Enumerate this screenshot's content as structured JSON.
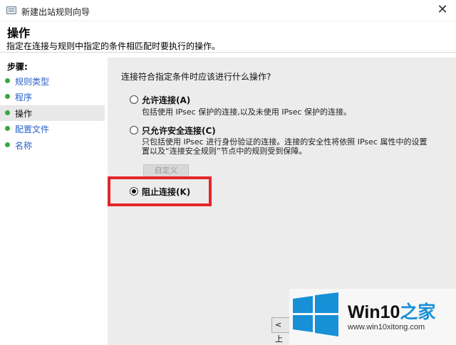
{
  "window": {
    "title": "新建出站规则向导",
    "close_glyph": "✕"
  },
  "header": {
    "title": "操作",
    "subtitle": "指定在连接与规则中指定的条件相匹配时要执行的操作。"
  },
  "sidebar": {
    "steps_label": "步骤:",
    "items": [
      {
        "label": "规则类型"
      },
      {
        "label": "程序"
      },
      {
        "label": "操作"
      },
      {
        "label": "配置文件"
      },
      {
        "label": "名称"
      }
    ]
  },
  "main": {
    "question": "连接符合指定条件时应该进行什么操作?",
    "options": [
      {
        "label": "允许连接(A)",
        "desc": "包括使用 IPsec 保护的连接,以及未使用 IPsec 保护的连接。",
        "selected": false
      },
      {
        "label": "只允许安全连接(C)",
        "desc1": "只包括使用 IPsec 进行身份验证的连接。连接的安全性将依照 IPsec 属性中的设置",
        "desc2": "置以及“连接安全规则”节点中的规则受到保障。",
        "selected": false
      },
      {
        "label": "阻止连接(K)",
        "selected": true
      }
    ],
    "customize_label": "自定义"
  },
  "footer": {
    "back_label": "< 上"
  },
  "watermark": {
    "brand": "Win10",
    "brand_suffix": "之家",
    "url": "www.win10xitong.com"
  },
  "colors": {
    "highlight": "#e3262a",
    "link": "#2760c8",
    "step_bullet": "#3aa83a",
    "logo_blue": "#1890d8"
  }
}
